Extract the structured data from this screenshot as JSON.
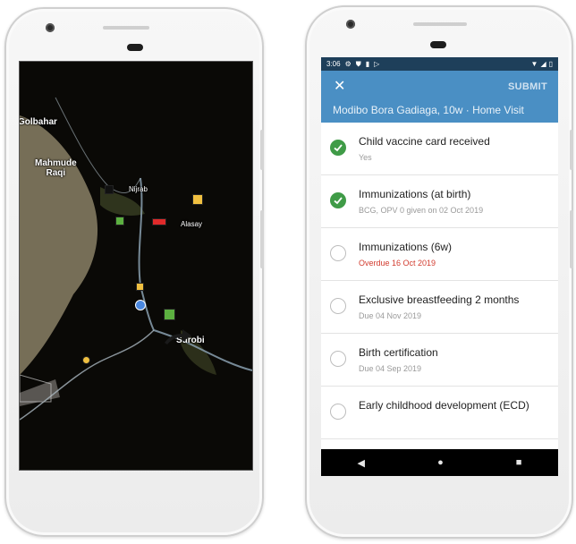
{
  "map": {
    "labels": [
      {
        "name": "golbahar",
        "text": "Golbahar"
      },
      {
        "name": "mahmude-raqi",
        "text": "Mahmude\nRaqi"
      },
      {
        "name": "nijrab",
        "text": "Nijrab"
      },
      {
        "name": "alasay",
        "text": "Alasay"
      },
      {
        "name": "surobi",
        "text": "Surobi"
      }
    ],
    "marker_colors": {
      "black": "#111111",
      "yellow": "#f0c040",
      "green": "#5cb040",
      "red": "#e02a2a",
      "blue": "#4a88e0"
    }
  },
  "status_bar": {
    "time": "3:06",
    "left_icons": [
      "gear-icon",
      "shield-icon",
      "lock-icon",
      "play-icon"
    ],
    "right_icons": [
      "wifi-icon",
      "signal-icon",
      "battery-icon"
    ]
  },
  "header": {
    "close_icon": "close-icon",
    "close_glyph": "✕",
    "submit_label": "SUBMIT",
    "title": "Modibo Bora Gadiaga, 10w · Home Visit",
    "color": "#4a8fc4"
  },
  "tasks": [
    {
      "name": "Child vaccine card received",
      "sub": "Yes",
      "done": true
    },
    {
      "name": "Immunizations (at birth)",
      "sub": "BCG, OPV 0  given on  02 Oct 2019",
      "done": true
    },
    {
      "name": "Immunizations (6w)",
      "sub": "Overdue  16 Oct 2019",
      "done": false,
      "overdue": true
    },
    {
      "name": "Exclusive breastfeeding 2 months",
      "sub": "Due 04 Nov 2019",
      "done": false
    },
    {
      "name": "Birth certification",
      "sub": "Due  04 Sep 2019",
      "done": false
    },
    {
      "name": "Early childhood development (ECD)",
      "sub": "",
      "done": false
    }
  ],
  "nav": {
    "back_glyph": "◀",
    "home_glyph": "●",
    "recents_glyph": "■"
  }
}
